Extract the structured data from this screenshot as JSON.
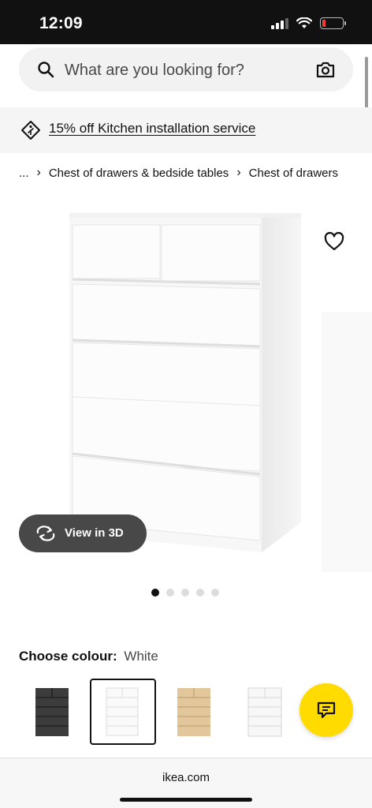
{
  "status_bar": {
    "time": "12:09"
  },
  "search": {
    "placeholder": "What are you looking for?"
  },
  "promo": {
    "text": "15% off Kitchen installation service"
  },
  "breadcrumb": {
    "items": [
      "...",
      "Chest of drawers & bedside tables",
      "Chest of drawers"
    ]
  },
  "view_3d": {
    "label": "View in 3D"
  },
  "carousel": {
    "total": 5,
    "active": 1
  },
  "colour": {
    "label": "Choose colour:",
    "value": "White",
    "swatches": [
      {
        "name": "black-brown",
        "selected": false
      },
      {
        "name": "white",
        "selected": true
      },
      {
        "name": "white-stained-oak",
        "selected": false
      },
      {
        "name": "high-gloss-white",
        "selected": false
      }
    ]
  },
  "browser": {
    "url": "ikea.com"
  },
  "colors": {
    "accent_yellow": "#ffdb00",
    "dark_button": "#484848",
    "battery_low": "#ff3b30"
  },
  "icons": [
    "search-icon",
    "camera-icon",
    "tag-icon",
    "heart-icon",
    "rotate-icon",
    "chat-icon"
  ]
}
